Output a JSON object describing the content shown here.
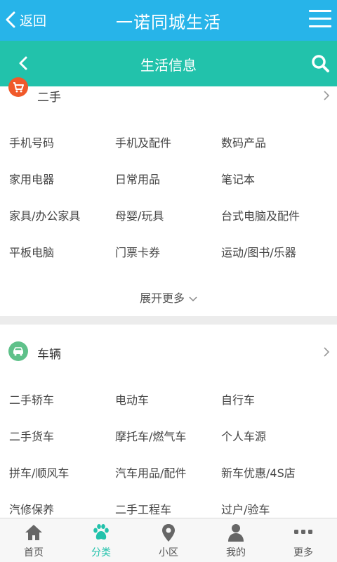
{
  "topbar": {
    "back_label": "返回",
    "title": "一诺同城生活"
  },
  "subbar": {
    "title": "生活信息"
  },
  "sections": [
    {
      "title": "二手",
      "icon": "cart-icon",
      "icon_color": "#f0592a",
      "items": [
        "手机号码",
        "手机及配件",
        "数码产品",
        "家用电器",
        "日常用品",
        "笔记本",
        "家具/办公家具",
        "母婴/玩具",
        "台式电脑及配件",
        "平板电脑",
        "门票卡券",
        "运动/图书/乐器"
      ],
      "expand_label": "展开更多"
    },
    {
      "title": "车辆",
      "icon": "car-icon",
      "icon_color": "#5fc18a",
      "items": [
        "二手轿车",
        "电动车",
        "自行车",
        "二手货车",
        "摩托车/燃气车",
        "个人车源",
        "拼车/顺风车",
        "汽车用品/配件",
        "新车优惠/4S店",
        "汽修保养",
        "二手工程车",
        "过户/验车"
      ]
    }
  ],
  "bottomnav": [
    {
      "label": "首页",
      "icon": "home-icon",
      "active": false
    },
    {
      "label": "分类",
      "icon": "paw-icon",
      "active": true
    },
    {
      "label": "小区",
      "icon": "location-pin-icon",
      "active": false
    },
    {
      "label": "我的",
      "icon": "user-icon",
      "active": false
    },
    {
      "label": "更多",
      "icon": "more-dots-icon",
      "active": false
    }
  ],
  "colors": {
    "topbar": "#27b4e9",
    "subbar": "#22c2ab",
    "accent": "#22c2ab"
  }
}
